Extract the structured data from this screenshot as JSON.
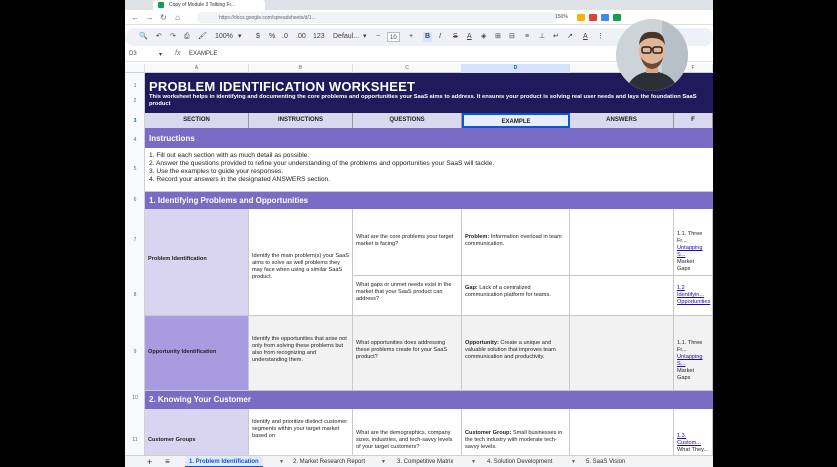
{
  "browser": {
    "tab_title": "Copy of Module 3 Talking Fr...",
    "url": "https://docs.google.com/spreadsheets/d/1...",
    "zoom_chip": "150%"
  },
  "toolbar": {
    "zoom": "100%",
    "currency": "$",
    "percent": "%",
    "dec_decrease": ".0",
    "dec_increase": ".00",
    "number_format": "123",
    "font": "Defaul...",
    "font_size": "10",
    "bold": "B",
    "italic": "I",
    "strike": "S",
    "underline_a": "A"
  },
  "formula_bar": {
    "cell_ref": "D3",
    "fx": "fx",
    "value": "EXAMPLE"
  },
  "columns": [
    {
      "label": "A",
      "selected": false
    },
    {
      "label": "B",
      "selected": false
    },
    {
      "label": "C",
      "selected": false
    },
    {
      "label": "D",
      "selected": true
    },
    {
      "label": "E",
      "selected": false
    },
    {
      "label": "F",
      "selected": false
    }
  ],
  "rows": [
    "1",
    "2",
    "3",
    "4",
    "5",
    "6",
    "7",
    "8",
    "9",
    "10",
    "11"
  ],
  "selected_row": "3",
  "sheet": {
    "title": "PROBLEM IDENTIFICATION WORKSHEET",
    "subtitle": "This worksheet helps in identifying and documenting the core problems and opportunities your SaaS aims to address. It ensures your product is solving real user needs and lays the foundation SaaS product",
    "headers": [
      "SECTION",
      "INSTRUCTIONS",
      "QUESTIONS",
      "EXAMPLE",
      "ANSWERS",
      "F"
    ],
    "instructions_title": "Instructions",
    "instructions": [
      "1. Fill out each section with as much detail as possible.",
      "2. Answer the questions provided to refine your understanding of the problems and opportunities your SaaS will tackle.",
      "3. Use the examples to guide your responses.",
      "4. Record your answers in the designated ANSWERS section."
    ],
    "section1": "1. Identifying Problems and Opportunities",
    "problem_label": "Problem Identification",
    "problem_instruction": "Identify the main problem(s) your SaaS aims to solve as well problems they may face when using a similar SaaS product.",
    "q1": "What are the core problems your target market is facing?",
    "ex1_label": "Problem:",
    "ex1_text": " Information overload in team communication.",
    "f1a": "1.1. Three Fr...",
    "f1b": "Untapping S...",
    "f1c": "Market Gaps",
    "q2": "What gaps or unmet needs exist in the market that your SaaS product can address?",
    "ex2_label": "Gap:",
    "ex2_text": " Lack of a centralized communication platform for teams.",
    "f2a": "1.2 Identifyin...",
    "f2b": "Opportunities",
    "opp_label": "Opportunity Identification",
    "opp_instruction": "Identify the opportunities that arise not only from solving these problems but also from recognizing and understanding them.",
    "q3": "What opportunities does addressing these problems create for your SaaS product?",
    "ex3_label": "Opportunity:",
    "ex3_text": " Create a unique and valuable solution that improves team communication and productivity.",
    "f3a": "1.1. Three Fr...",
    "f3b": "Untapping S...",
    "f3c": "Market Gaps",
    "section2": "2. Knowing Your Customer",
    "cust_label": "Customer Groups",
    "cust_instruction": "Identify and prioritize distinct customer segments within your target market based on",
    "q4": "What are the demographics, company sizes, industries, and tech-savvy levels of your target customers?",
    "ex4_label": "Customer Group:",
    "ex4_text": " Small businesses in the tech industry with moderate tech-savvy levels.",
    "f4a": "1.3. Custom...",
    "f4b": "What They..."
  },
  "sheet_tabs": {
    "add": "+",
    "list": "≡",
    "tabs": [
      {
        "label": "1. Problem Identification",
        "active": true
      },
      {
        "label": "2. Market Research Report",
        "active": false
      },
      {
        "label": "3. Competitive Matrix",
        "active": false
      },
      {
        "label": "4. Solution Development",
        "active": false
      },
      {
        "label": "5. SaaS Vision",
        "active": false
      }
    ]
  },
  "colors": {
    "header_bg": "#1f1a5c",
    "section_bg": "#7a6bc4",
    "column_header_bg": "#d9d8ec",
    "label_lavender": "#d9d4ef",
    "label_purple": "#a99be0",
    "row_gray": "#f2f2f2",
    "accent_blue": "#0b57d0"
  }
}
